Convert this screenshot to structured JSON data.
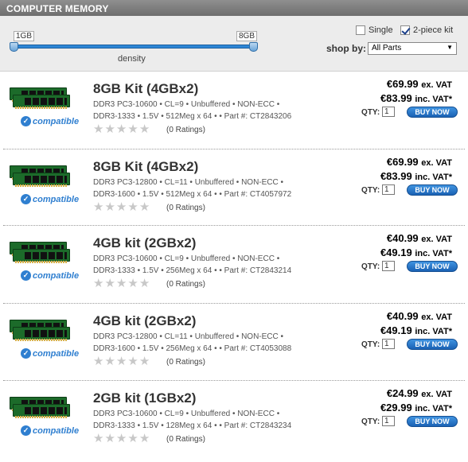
{
  "header": {
    "title": "COMPUTER MEMORY"
  },
  "filter": {
    "slider_min": "1GB",
    "slider_max": "8GB",
    "slider_label": "density",
    "single_label": "Single",
    "twopiece_label": "2-piece kit",
    "shop_by_label": "shop by:",
    "shop_by_value": "All Parts"
  },
  "common": {
    "compatible": "compatible",
    "qty_label": "QTY:",
    "buy_label": "BUY NOW",
    "ex_vat": "ex. VAT",
    "inc_vat": "inc. VAT*"
  },
  "products": [
    {
      "title": "8GB Kit (4GBx2)",
      "spec1": "DDR3 PC3-10600 • CL=9 • Unbuffered • NON-ECC •",
      "spec2": "DDR3-1333 • 1.5V • 512Meg x 64 •  •  Part #: CT2843206",
      "ratings": "(0 Ratings)",
      "price_ex": "€69.99",
      "price_inc": "€83.99",
      "qty": "1"
    },
    {
      "title": "8GB Kit (4GBx2)",
      "spec1": "DDR3 PC3-12800 • CL=11 • Unbuffered • NON-ECC •",
      "spec2": "DDR3-1600 • 1.5V • 512Meg x 64 •  •  Part #: CT4057972",
      "ratings": "(0 Ratings)",
      "price_ex": "€69.99",
      "price_inc": "€83.99",
      "qty": "1"
    },
    {
      "title": "4GB kit (2GBx2)",
      "spec1": "DDR3 PC3-10600 • CL=9 • Unbuffered • NON-ECC •",
      "spec2": "DDR3-1333 • 1.5V • 256Meg x 64 •  •  Part #: CT2843214",
      "ratings": "(0 Ratings)",
      "price_ex": "€40.99",
      "price_inc": "€49.19",
      "qty": "1"
    },
    {
      "title": "4GB kit (2GBx2)",
      "spec1": "DDR3 PC3-12800 • CL=11 • Unbuffered • NON-ECC •",
      "spec2": "DDR3-1600 • 1.5V • 256Meg x 64 •  •  Part #: CT4053088",
      "ratings": "(0 Ratings)",
      "price_ex": "€40.99",
      "price_inc": "€49.19",
      "qty": "1"
    },
    {
      "title": "2GB kit (1GBx2)",
      "spec1": "DDR3 PC3-10600 • CL=9 • Unbuffered • NON-ECC •",
      "spec2": "DDR3-1333 • 1.5V • 128Meg x 64 •  •  Part #: CT2843234",
      "ratings": "(0 Ratings)",
      "price_ex": "€24.99",
      "price_inc": "€29.99",
      "qty": "1"
    }
  ]
}
